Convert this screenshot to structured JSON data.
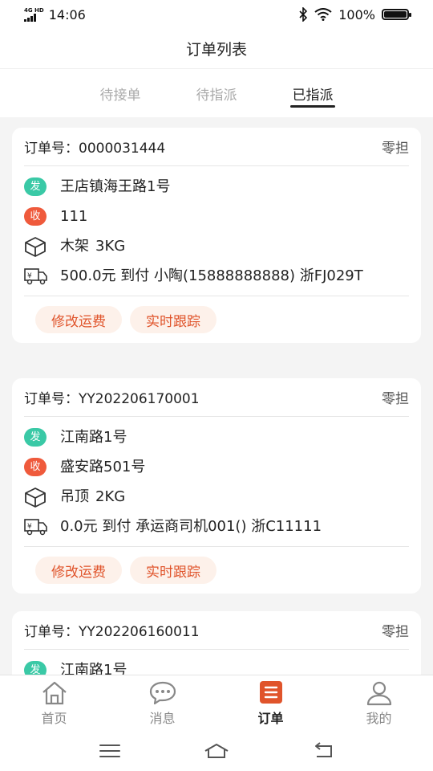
{
  "statusbar": {
    "net": "4G HD",
    "time": "14:06",
    "battery": "100%"
  },
  "header": {
    "title": "订单列表"
  },
  "tabs": [
    {
      "label": "待接单",
      "active": false
    },
    {
      "label": "待指派",
      "active": false
    },
    {
      "label": "已指派",
      "active": true
    }
  ],
  "orders": [
    {
      "order_label": "订单号：0000031444",
      "type": "零担",
      "send_badge": "发",
      "send_addr": "王店镇海王路1号",
      "recv_badge": "收",
      "recv_addr": "111",
      "goods": "木架",
      "weight": "3KG",
      "transport": "500.0元  到付  小陶(15888888888)  浙FJ029T"
    },
    {
      "order_label": "订单号：YY202206170001",
      "type": "零担",
      "send_badge": "发",
      "send_addr": "江南路1号",
      "recv_badge": "收",
      "recv_addr": "盛安路501号",
      "goods": "吊顶",
      "weight": "2KG",
      "transport": "0.0元  到付  承运商司机001()  浙C11111"
    },
    {
      "order_label": "订单号：YY202206160011",
      "type": "零担",
      "send_badge": "发",
      "send_addr": "江南路1号"
    }
  ],
  "actions": {
    "edit_fee": "修改运费",
    "track": "实时跟踪"
  },
  "bottomnav": [
    {
      "label": "首页",
      "icon": "home-icon",
      "active": false
    },
    {
      "label": "消息",
      "icon": "message-icon",
      "active": false
    },
    {
      "label": "订单",
      "icon": "order-icon",
      "active": true
    },
    {
      "label": "我的",
      "icon": "profile-icon",
      "active": false
    }
  ],
  "colors": {
    "accent": "#e0542b",
    "send": "#3ac9a6",
    "recv": "#ef5a3c",
    "pill_bg": "#fdf1ea"
  }
}
